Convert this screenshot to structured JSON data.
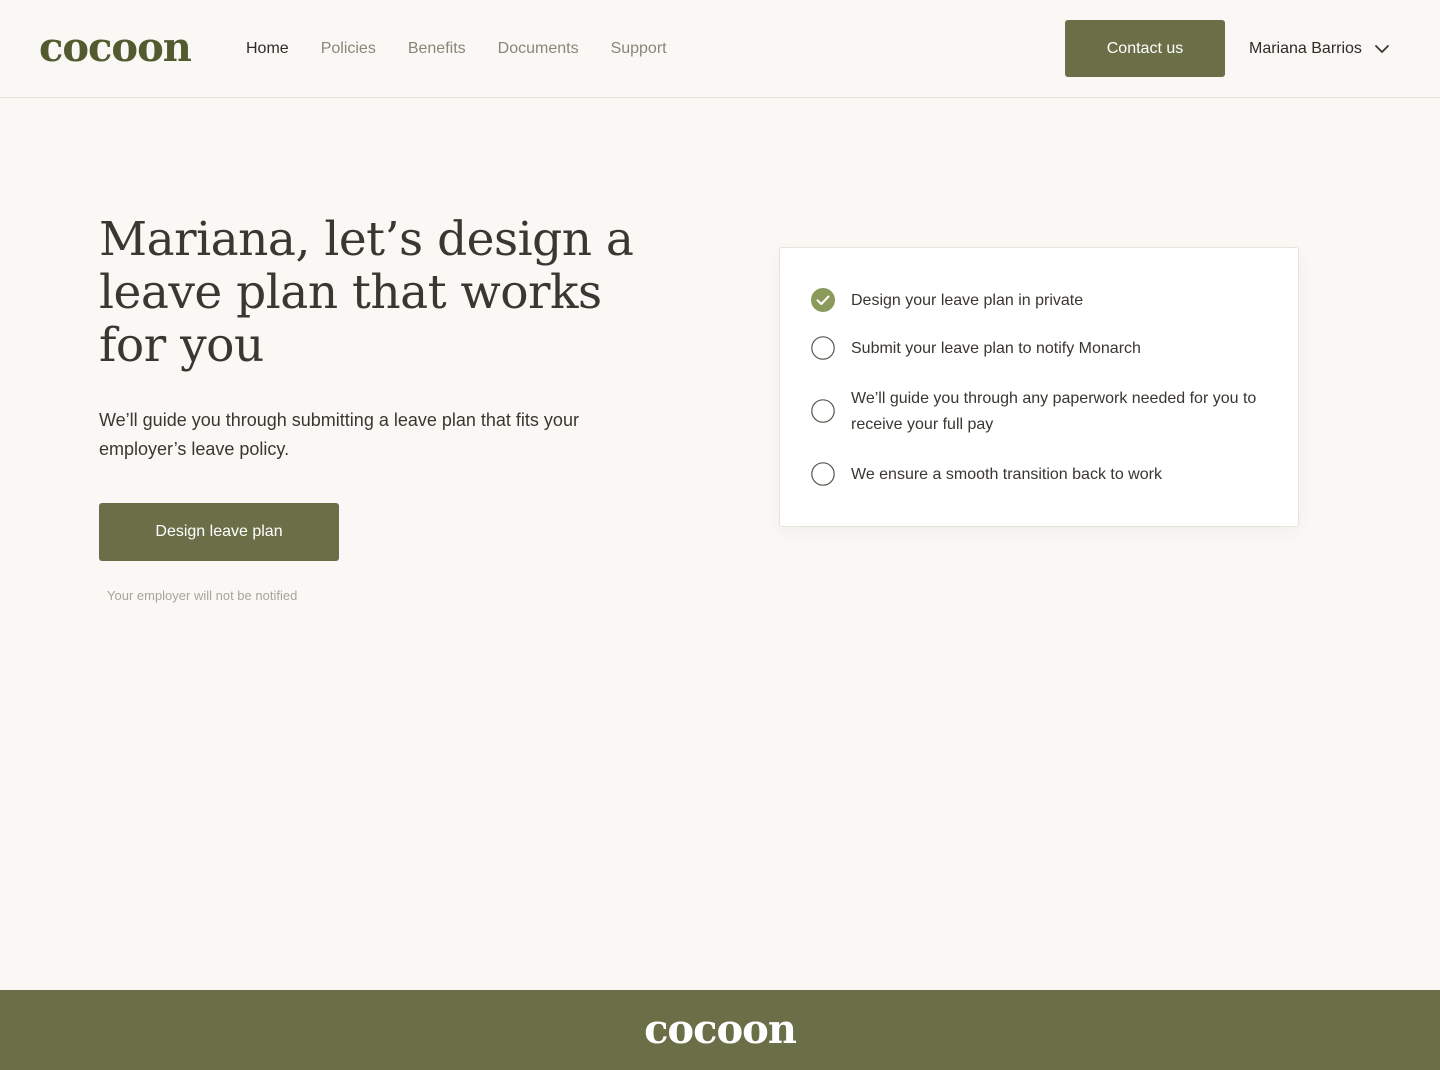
{
  "header": {
    "logo": "cocoon",
    "nav": [
      {
        "label": "Home"
      },
      {
        "label": "Policies"
      },
      {
        "label": "Benefits"
      },
      {
        "label": "Documents"
      },
      {
        "label": "Support"
      }
    ],
    "contact_label": "Contact us",
    "user_name": "Mariana Barrios"
  },
  "hero": {
    "title": "Mariana, let’s design a leave plan that works for you",
    "subtitle": "We’ll guide you through submitting a leave plan that fits your employer’s leave policy.",
    "cta_label": "Design leave plan",
    "note": "Your employer will not be notified"
  },
  "steps": [
    {
      "text": "Design your leave plan in private",
      "done": true
    },
    {
      "text": "Submit your leave plan to notify Monarch",
      "done": false
    },
    {
      "text": "We’ll guide you through any paperwork needed for you to receive your full pay",
      "done": false
    },
    {
      "text": "We ensure a smooth transition back to work",
      "done": false
    }
  ],
  "footer": {
    "logo": "cocoon"
  },
  "colors": {
    "brand": "#6b6f48",
    "logo": "#545a30",
    "check": "#8a9a5b",
    "background": "#f9f8f4"
  }
}
